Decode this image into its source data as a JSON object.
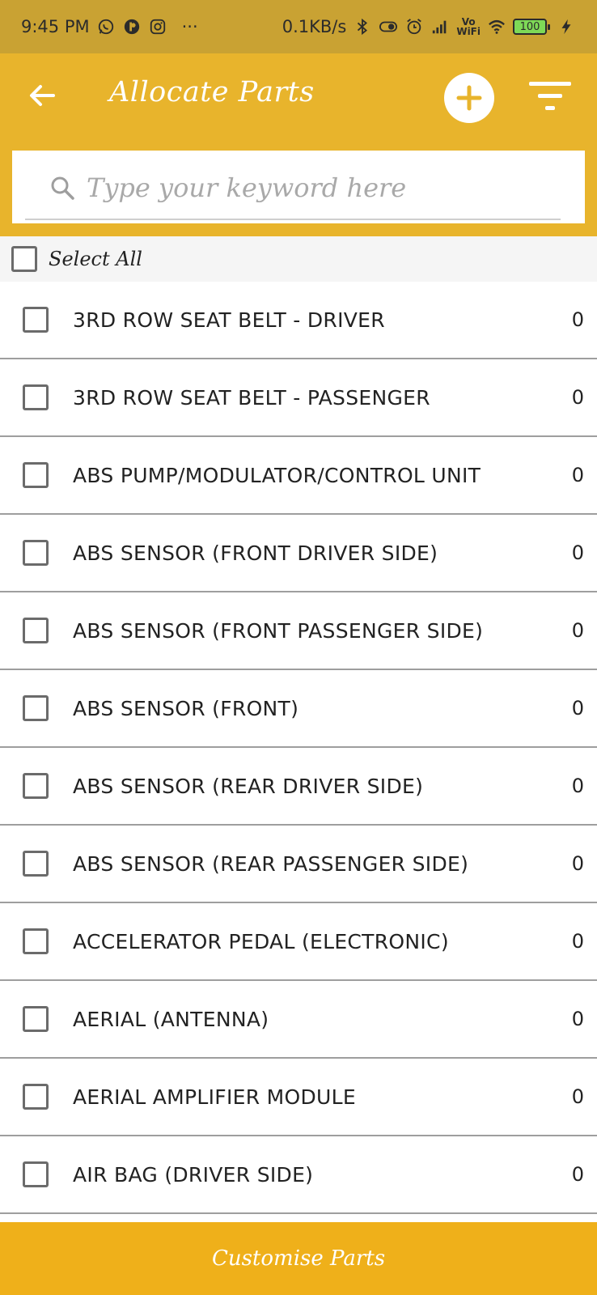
{
  "status_bar": {
    "time": "9:45 PM",
    "more": "···",
    "speed": "0.1KB/s",
    "volte_top": "Vo",
    "volte_bottom": "WiFi",
    "battery": "100",
    "icons": [
      "whatsapp-icon",
      "app-icon",
      "instagram-icon",
      "bluetooth-icon",
      "toggle-icon",
      "alarm-icon",
      "signal-icon",
      "wifi-icon",
      "battery-icon",
      "charging-icon"
    ]
  },
  "app_bar": {
    "title": "Allocate Parts",
    "icons": [
      "back-arrow-icon",
      "plus-icon",
      "filter-icon"
    ]
  },
  "search": {
    "placeholder": "Type your keyword here",
    "value": ""
  },
  "select_all": {
    "label": "Select All",
    "checked": false
  },
  "parts": [
    {
      "name": "3RD ROW SEAT BELT - DRIVER",
      "qty": "0",
      "checked": false
    },
    {
      "name": "3RD ROW SEAT BELT - PASSENGER",
      "qty": "0",
      "checked": false
    },
    {
      "name": "ABS PUMP/MODULATOR/CONTROL UNIT",
      "qty": "0",
      "checked": false
    },
    {
      "name": "ABS SENSOR (FRONT DRIVER SIDE)",
      "qty": "0",
      "checked": false
    },
    {
      "name": "ABS SENSOR (FRONT PASSENGER SIDE)",
      "qty": "0",
      "checked": false
    },
    {
      "name": "ABS SENSOR (FRONT)",
      "qty": "0",
      "checked": false
    },
    {
      "name": "ABS SENSOR (REAR DRIVER SIDE)",
      "qty": "0",
      "checked": false
    },
    {
      "name": "ABS SENSOR (REAR PASSENGER SIDE)",
      "qty": "0",
      "checked": false
    },
    {
      "name": "ACCELERATOR PEDAL (ELECTRONIC)",
      "qty": "0",
      "checked": false
    },
    {
      "name": "AERIAL (ANTENNA)",
      "qty": "0",
      "checked": false
    },
    {
      "name": "AERIAL AMPLIFIER MODULE",
      "qty": "0",
      "checked": false
    },
    {
      "name": "AIR BAG (DRIVER SIDE)",
      "qty": "0",
      "checked": false
    }
  ],
  "bottom_button": {
    "label": "Customise Parts"
  },
  "colors": {
    "status_bar": "#c9a233",
    "app_bar": "#e8b42c",
    "bottom_button": "#efb01a",
    "divider": "#9e9e9e"
  }
}
